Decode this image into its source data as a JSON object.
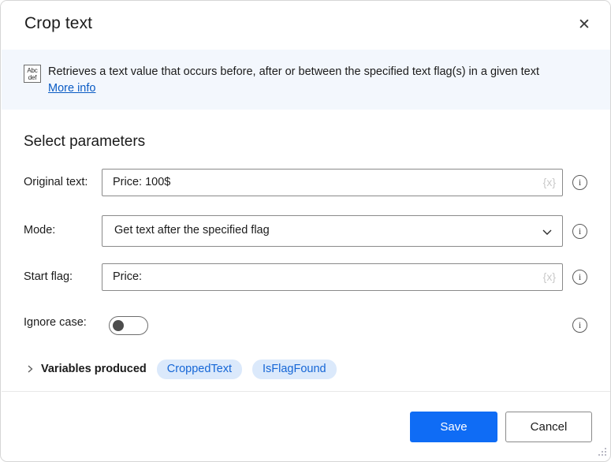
{
  "window": {
    "title": "Crop text",
    "close_icon": "close-icon"
  },
  "banner": {
    "icon": "abc-def-text-icon",
    "icon_line1": "Abc",
    "icon_line2": "def",
    "description": "Retrieves a text value that occurs before, after or between the specified text flag(s) in a given text",
    "link_label": "More info"
  },
  "body": {
    "section_title": "Select parameters",
    "fields": [
      {
        "label": "Original text:",
        "value": "Price: 100$",
        "variable_glyph": "{x}",
        "info_icon": "info-icon"
      },
      {
        "label": "Mode:",
        "value": "Get text after the specified flag",
        "info_icon": "info-icon"
      },
      {
        "label": "Start flag:",
        "value": "Price:",
        "variable_glyph": "{x}",
        "info_icon": "info-icon"
      },
      {
        "label": "Ignore case:",
        "value": "off",
        "info_icon": "info-icon"
      }
    ],
    "variables_produced": {
      "label": "Variables produced",
      "expanded": false,
      "chips": [
        "CroppedText",
        "IsFlagFound"
      ]
    }
  },
  "footer": {
    "save_label": "Save",
    "cancel_label": "Cancel"
  },
  "colors": {
    "accent": "#0f6cf5",
    "banner_bg": "#f3f7fd",
    "link": "#0a5bc4",
    "chip_bg": "#dbe9fb",
    "chip_text": "#1566d6"
  }
}
